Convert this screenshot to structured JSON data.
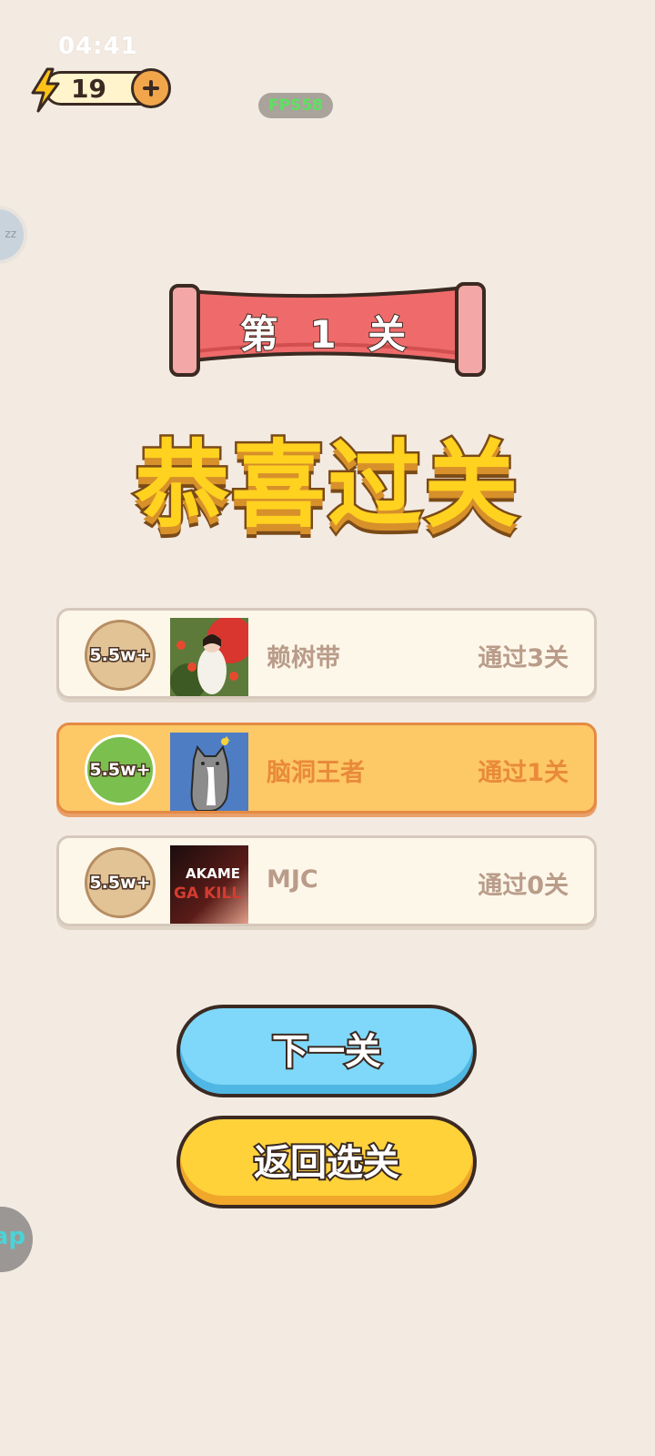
{
  "status_bar": {
    "time": "04:41"
  },
  "energy": {
    "count": "19"
  },
  "fps_label": "FPS58",
  "float_top_label": "zz",
  "float_bottom_label": "ap",
  "level_banner": "第 1 关",
  "headline": "恭喜过关",
  "ranking": [
    {
      "badge": "5.5w+",
      "name": "赖树带",
      "progress": "通过3关",
      "is_me": false
    },
    {
      "badge": "5.5w+",
      "name": "脑洞王者",
      "progress": "通过1关",
      "is_me": true
    },
    {
      "badge": "5.5w+",
      "name": "MJC",
      "progress": "通过0关",
      "is_me": false
    }
  ],
  "avatar3_text": {
    "line1": "AKAME",
    "line2": "GA KILL"
  },
  "buttons": {
    "next": "下一关",
    "back": "返回选关"
  },
  "colors": {
    "background": "#f3ebe2",
    "banner_red": "#ef6b6b",
    "headline_yellow": "#ffd21f",
    "next_button": "#7fd8f9",
    "back_button": "#ffd23a",
    "highlight_row": "#fdc866"
  }
}
